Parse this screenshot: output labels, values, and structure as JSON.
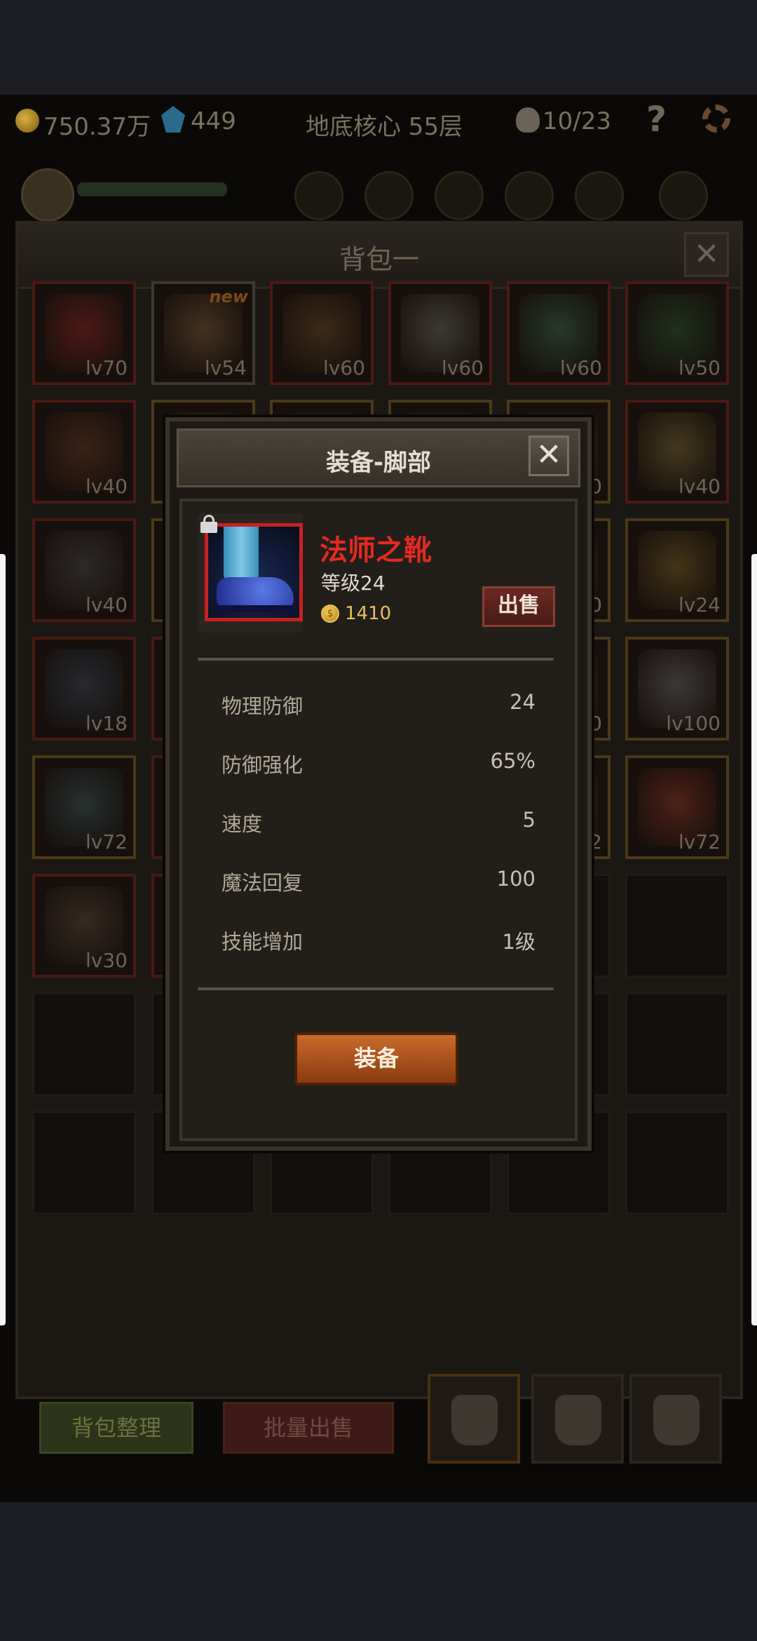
{
  "hud": {
    "gold": "750.37万",
    "gems": "449",
    "location": "地底核心 55层",
    "kills": "10/23",
    "help": "?"
  },
  "bag": {
    "title": "背包一",
    "close": "✕",
    "sort_label": "背包整理",
    "bulk_sell_label": "批量出售",
    "items": [
      {
        "lv": "lv70",
        "frame": "red",
        "art": "#8a2a20"
      },
      {
        "lv": "lv54",
        "frame": "white",
        "art": "#7a5a30",
        "new": "new"
      },
      {
        "lv": "lv60",
        "frame": "red",
        "art": "#6a4a20"
      },
      {
        "lv": "lv60",
        "frame": "red",
        "art": "#6a6a60"
      },
      {
        "lv": "lv60",
        "frame": "red",
        "art": "#3a6a50"
      },
      {
        "lv": "lv50",
        "frame": "red",
        "art": "#2a5a30"
      },
      {
        "lv": "lv40",
        "frame": "red",
        "art": "#6a3a20"
      },
      {
        "lv": "",
        "frame": "gold",
        "art": "#6a5020"
      },
      {
        "lv": "",
        "frame": "gold",
        "art": "#4a4030"
      },
      {
        "lv": "",
        "frame": "gold",
        "art": "#4a4030"
      },
      {
        "lv": "0",
        "frame": "gold",
        "art": "#4a4030"
      },
      {
        "lv": "lv40",
        "frame": "red",
        "art": "#7a6a30"
      },
      {
        "lv": "lv40",
        "frame": "red",
        "art": "#4a4a4a"
      },
      {
        "lv": "",
        "frame": "gold",
        "art": "#4a4030"
      },
      {
        "lv": "",
        "frame": "gold",
        "art": "#4a4030"
      },
      {
        "lv": "",
        "frame": "gold",
        "art": "#4a4030"
      },
      {
        "lv": "0",
        "frame": "gold",
        "art": "#4a4030"
      },
      {
        "lv": "lv24",
        "frame": "gold",
        "art": "#7a6020"
      },
      {
        "lv": "lv18",
        "frame": "red",
        "art": "#3a4a5a"
      },
      {
        "lv": "",
        "frame": "red",
        "art": "#4a4a4a"
      },
      {
        "lv": "",
        "frame": "gold",
        "art": "#4a4030"
      },
      {
        "lv": "",
        "frame": "gold",
        "art": "#4a4030"
      },
      {
        "lv": "00",
        "frame": "gold",
        "art": "#4a4030"
      },
      {
        "lv": "lv100",
        "frame": "gold",
        "art": "#6a6a6a"
      },
      {
        "lv": "lv72",
        "frame": "gold",
        "art": "#3a5a5a"
      },
      {
        "lv": "",
        "frame": "red",
        "art": "#6a2a2a"
      },
      {
        "lv": "",
        "frame": "gold",
        "art": "#4a4030"
      },
      {
        "lv": "",
        "frame": "gold",
        "art": "#4a4030"
      },
      {
        "lv": "2",
        "frame": "gold",
        "art": "#4a4030"
      },
      {
        "lv": "lv72",
        "frame": "gold",
        "art": "#8a3a20"
      },
      {
        "lv": "lv30",
        "frame": "red",
        "art": "#5a4a3a"
      },
      {
        "lv": "",
        "frame": "red",
        "art": "#5a4020"
      }
    ]
  },
  "modal": {
    "title": "装备-脚部",
    "close": "✕",
    "item": {
      "name": "法师之靴",
      "level": "等级24",
      "coin": "$",
      "price": "1410",
      "rarity_color": "#e22a22"
    },
    "sell_label": "出售",
    "stats": [
      {
        "name": "物理防御",
        "value": "24"
      },
      {
        "name": "防御强化",
        "value": "65%"
      },
      {
        "name": "速度",
        "value": "5"
      },
      {
        "name": "魔法回复",
        "value": "100"
      },
      {
        "name": "技能增加",
        "value": "1级"
      }
    ],
    "equip_label": "装备"
  }
}
